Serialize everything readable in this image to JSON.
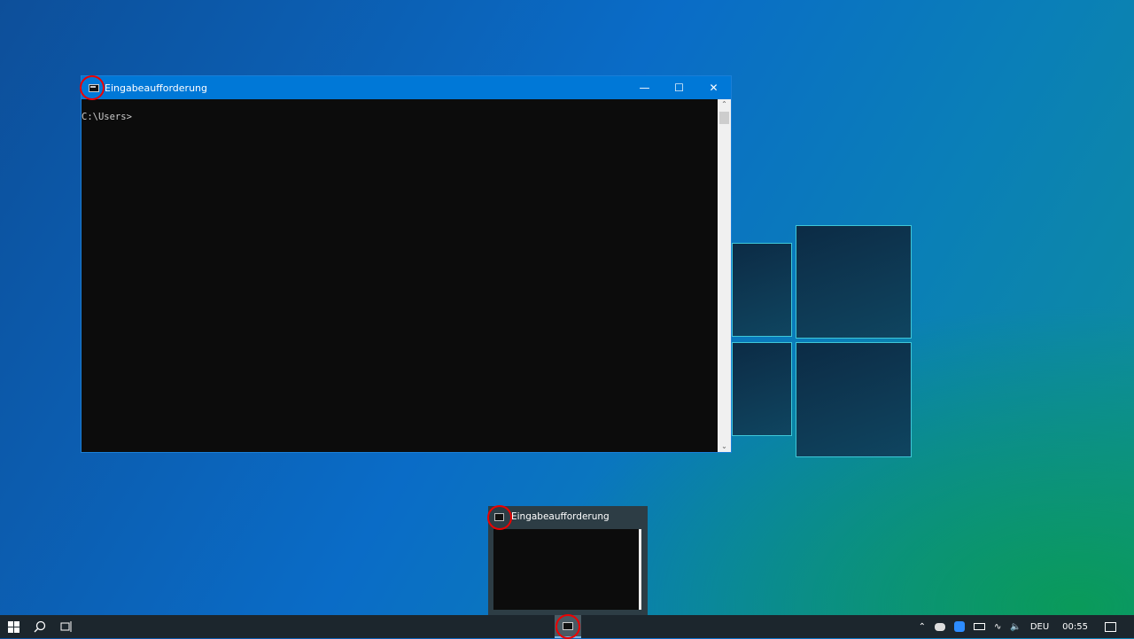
{
  "window": {
    "title": "Eingabeaufforderung",
    "console_text": "C:\\Users>",
    "minimize_icon": "minimize-icon",
    "maximize_icon": "maximize-icon",
    "close_icon": "close-icon"
  },
  "taskbar_preview": {
    "title": "Eingabeaufforderung"
  },
  "taskbar": {
    "language": "DEU",
    "time": "00:55"
  },
  "colors": {
    "titlebar": "#0078d7",
    "console_bg": "#0c0c0c",
    "taskbar": "#1c262d",
    "annotation": "#e00000"
  }
}
